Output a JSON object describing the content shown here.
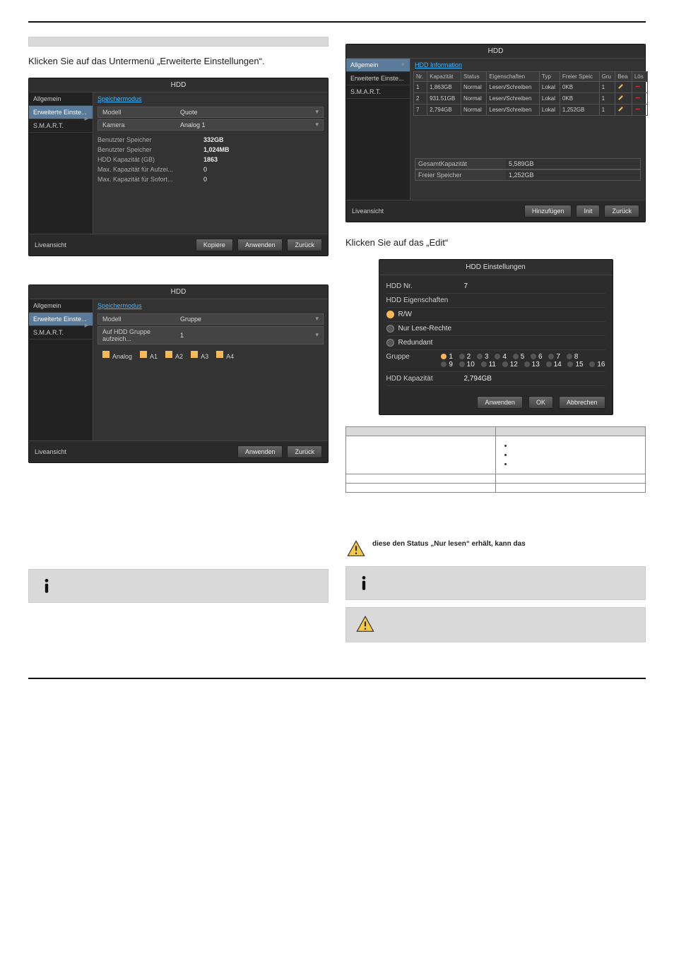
{
  "intro_box": " ",
  "body1": "Klicken Sie auf das Untermenü „Erweiterte Einstellungen“.",
  "app_quota": {
    "title": "HDD",
    "sidebar": [
      "Allgemein",
      "Erweiterte Einste...",
      "S.M.A.R.T."
    ],
    "link": "Speichermodus",
    "rows": [
      {
        "label": "Modell",
        "value": "Quote"
      },
      {
        "label": "Kamera",
        "value": "Analog 1"
      },
      {
        "label": "Benutzter Speicher",
        "value": "332GB"
      },
      {
        "label": "Benutzter Speicher",
        "value": "1,024MB"
      },
      {
        "label": "HDD Kapazität (GB)",
        "value": "1863"
      },
      {
        "label": "Max. Kapazität für Aufzei...",
        "value": "0"
      },
      {
        "label": "Max. Kapazität für Sofort...",
        "value": "0"
      }
    ],
    "footer_link": "Liveansicht",
    "buttons": [
      "Kopiere",
      "Anwenden",
      "Zurück"
    ]
  },
  "app_group": {
    "title": "HDD",
    "sidebar": [
      "Allgemein",
      "Erweiterte Einste...",
      "S.M.A.R.T."
    ],
    "link": "Speichermodus",
    "select1": {
      "label": "Modell",
      "value": "Gruppe"
    },
    "select2": {
      "label": "Auf HDD Gruppe aufzeich...",
      "value": "1"
    },
    "chk_lead": "Analog",
    "chks": [
      "A1",
      "A2",
      "A3",
      "A4"
    ],
    "footer_link": "Liveansicht",
    "buttons": [
      "Anwenden",
      "Zurück"
    ]
  },
  "app_info": {
    "title": "HDD",
    "sidebar": [
      "Allgemein",
      "Erweiterte Einste...",
      "S.M.A.R.T."
    ],
    "active": 0,
    "link": "HDD Information",
    "thead": [
      "Nr.",
      "Kapazität",
      "Status",
      "Eigenschaften",
      "Typ",
      "Freier Speic",
      "Gru",
      "Bea",
      "Lös"
    ],
    "rows": [
      {
        "nr": "1",
        "cap": "1,863GB",
        "status": "Normal",
        "prop": "Lesen/Schreiben",
        "typ": "Lokal",
        "free": "0KB",
        "grp": "1"
      },
      {
        "nr": "2",
        "cap": "931.51GB",
        "status": "Normal",
        "prop": "Lesen/Schreiben",
        "typ": "Lokal",
        "free": "0KB",
        "grp": "1"
      },
      {
        "nr": "7",
        "cap": "2,794GB",
        "status": "Normal",
        "prop": "Lesen/Schreiben",
        "typ": "Lokal",
        "free": "1,252GB",
        "grp": "1"
      }
    ],
    "summary": [
      {
        "label": "GesamtKapazität",
        "value": "5,589GB"
      },
      {
        "label": "Freier Speicher",
        "value": "1,252GB"
      }
    ],
    "footer_link": "Liveansicht",
    "buttons": [
      "Hinzufügen",
      "Init",
      "Zurück"
    ]
  },
  "body2": "Klicken Sie auf das „Edit“",
  "dlg": {
    "title": "HDD Einstellungen",
    "rows": {
      "nr_label": "HDD Nr.",
      "nr_value": "7",
      "props_label": "HDD Eigenschaften",
      "rw": "R/W",
      "ro": "Nur Lese-Rechte",
      "red": "Redundant",
      "grp_label": "Gruppe",
      "cap_label": "HDD Kapazität",
      "cap_value": "2,794GB"
    },
    "groups_row1": [
      "1",
      "2",
      "3",
      "4",
      "5",
      "6",
      "7",
      "8"
    ],
    "groups_row2": [
      "9",
      "10",
      "11",
      "12",
      "13",
      "14",
      "15",
      "16"
    ],
    "buttons": [
      "Anwenden",
      "OK",
      "Abbrechen"
    ]
  },
  "info_table": {
    "hdr1": " ",
    "hdr2": " ",
    "r1c1": " ",
    "r1c2_items": [
      " ",
      " ",
      " "
    ],
    "r2c1": " ",
    "r2c2": " ",
    "r3c1": " ",
    "r3c2": " "
  },
  "warn1_bold": "diese den Status „Nur lesen“ erhält, kann das",
  "warn1_rest": " ",
  "note_left": " ",
  "note_right": " ",
  "warn2": " "
}
